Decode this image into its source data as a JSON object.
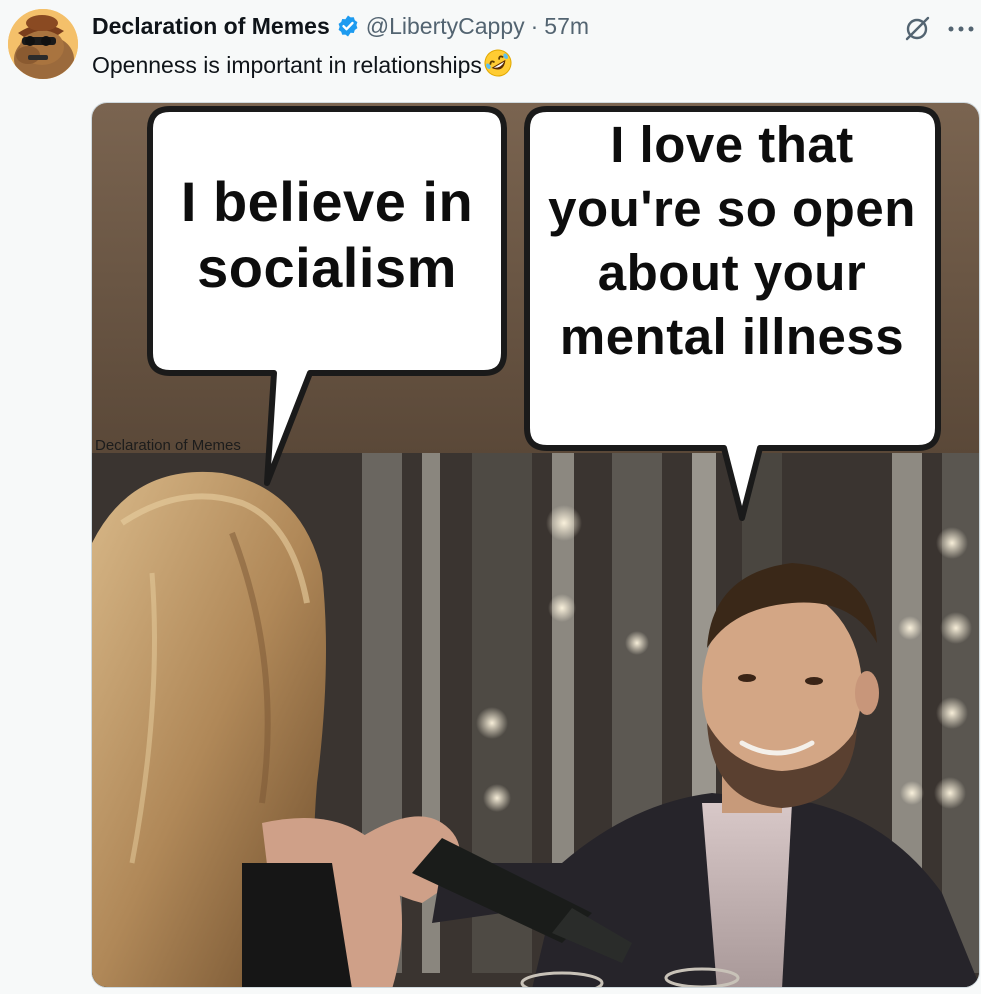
{
  "tweet": {
    "display_name": "Declaration of Memes",
    "handle": "@LibertyCappy",
    "separator": "·",
    "time": "57m",
    "text": "Openness is important in relationships",
    "emoji": "rolling-on-floor-laughing",
    "verified": true
  },
  "icons": {
    "verified": "verified-badge-icon",
    "grok": "grok-slash-icon",
    "more": "more-options-icon"
  },
  "meme": {
    "left_bubble": "I believe in socialism",
    "right_bubble": "I love that you're so open about your mental illness",
    "watermark": "Declaration of Memes"
  },
  "colors": {
    "verified_blue": "#1d9bf0",
    "text_primary": "#0f1419",
    "text_secondary": "#536471",
    "background": "#f7f9f9"
  }
}
